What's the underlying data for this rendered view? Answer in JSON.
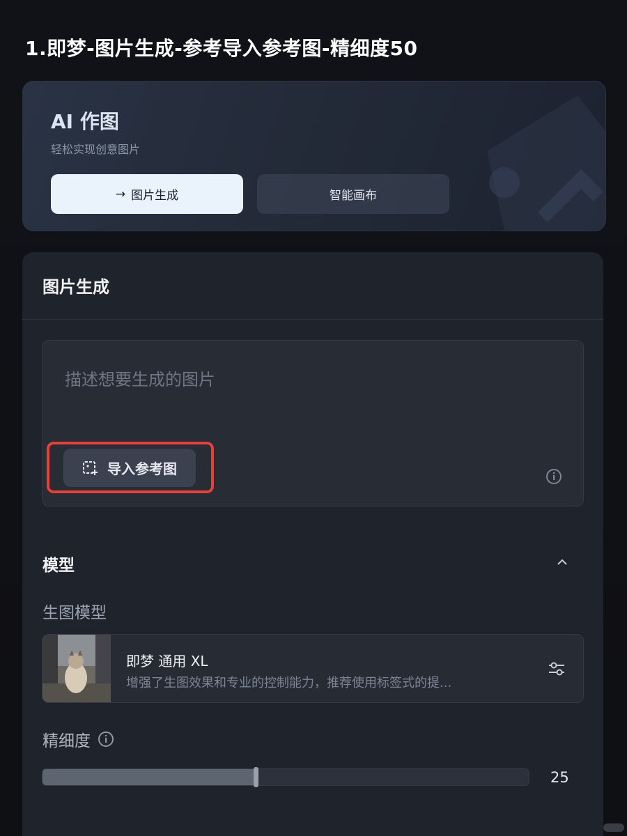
{
  "caption": "1.即梦-图片生成-参考导入参考图-精细度50",
  "hero": {
    "title": "AI 作图",
    "subtitle": "轻松实现创意图片",
    "primary_button": "图片生成",
    "secondary_button": "智能画布"
  },
  "panel": {
    "title": "图片生成",
    "prompt_placeholder": "描述想要生成的图片",
    "import_reference_label": "导入参考图",
    "model_section_title": "模型",
    "model_sub_label": "生图模型",
    "model": {
      "name": "即梦 通用 XL",
      "description": "增强了生图效果和专业的控制能力，推荐使用标签式的提..."
    },
    "detail_label": "精细度",
    "detail_value": "25",
    "detail_fraction": 0.44
  },
  "colors": {
    "highlight": "#e5403a",
    "accent_light": "#eaf2fb"
  }
}
